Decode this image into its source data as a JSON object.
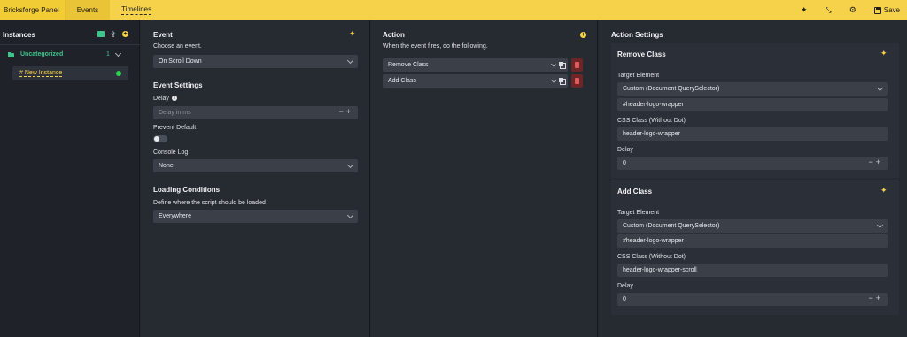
{
  "topbar": {
    "brand": "Bricksforge Panel",
    "tabs": [
      {
        "label": "Events"
      },
      {
        "label": "Timelines"
      }
    ],
    "save_label": "Save"
  },
  "instances": {
    "title": "Instances",
    "folder": {
      "label": "Uncategorized",
      "count": "1"
    },
    "item": {
      "label": "# New Instance"
    }
  },
  "event": {
    "title": "Event",
    "choose_label": "Choose an event.",
    "selected": "On Scroll Down",
    "settings_title": "Event Settings",
    "delay_label": "Delay",
    "delay_placeholder": "Delay in ms",
    "prevent_label": "Prevent Default",
    "console_label": "Console Log",
    "console_value": "None",
    "loading_title": "Loading Conditions",
    "loading_desc": "Define where the script should be loaded",
    "loading_value": "Everywhere"
  },
  "action": {
    "title": "Action",
    "desc": "When the event fires, do the following.",
    "items": [
      {
        "label": "Remove Class"
      },
      {
        "label": "Add Class"
      }
    ]
  },
  "settings": {
    "title": "Action Settings",
    "cards": [
      {
        "title": "Remove Class",
        "target_label": "Target Element",
        "target_value": "Custom (Document QuerySelector)",
        "selector": "#header-logo-wrapper",
        "class_label": "CSS Class (Without Dot)",
        "class_value": "header-logo-wrapper",
        "delay_label": "Delay",
        "delay_value": "0"
      },
      {
        "title": "Add Class",
        "target_label": "Target Element",
        "target_value": "Custom (Document QuerySelector)",
        "selector": "#header-logo-wrapper",
        "class_label": "CSS Class (Without Dot)",
        "class_value": "header-logo-wrapper-scroll",
        "delay_label": "Delay",
        "delay_value": "0"
      }
    ]
  },
  "colors": {
    "accent": "#f5d24a",
    "panel_bg": "#262a31",
    "field_bg": "#3a3f48",
    "green": "#2fcf4f",
    "danger": "#6e2528"
  },
  "icons": [
    "add-folder-icon",
    "export-icon",
    "plus-circle-icon",
    "sparkle-icon",
    "collapse-icon",
    "gear-icon",
    "save-icon",
    "copy-icon",
    "trash-icon",
    "info-icon"
  ]
}
